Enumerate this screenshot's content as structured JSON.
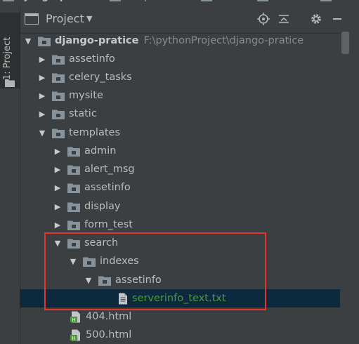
{
  "breadcrumb": [
    "django-pratice",
    "templates",
    "search",
    "indexes",
    "asse"
  ],
  "tool_window": {
    "stripe_label": "1: Project",
    "title": "Project"
  },
  "tree": {
    "root": {
      "name": "django-pratice",
      "path": "F:\\pythonProject\\django-pratice"
    },
    "items": [
      {
        "name": "assetinfo",
        "kind": "folder"
      },
      {
        "name": "celery_tasks",
        "kind": "folder"
      },
      {
        "name": "mysite",
        "kind": "folder"
      },
      {
        "name": "static",
        "kind": "folder"
      },
      {
        "name": "templates",
        "kind": "folder"
      },
      {
        "name": "admin",
        "kind": "folder"
      },
      {
        "name": "alert_msg",
        "kind": "folder"
      },
      {
        "name": "assetinfo",
        "kind": "folder"
      },
      {
        "name": "display",
        "kind": "folder"
      },
      {
        "name": "form_test",
        "kind": "folder"
      },
      {
        "name": "search",
        "kind": "folder"
      },
      {
        "name": "indexes",
        "kind": "folder"
      },
      {
        "name": "assetinfo",
        "kind": "folder"
      },
      {
        "name": "serverinfo_text.txt",
        "kind": "text-file"
      },
      {
        "name": "404.html",
        "kind": "html-file"
      },
      {
        "name": "500.html",
        "kind": "html-file"
      }
    ]
  },
  "colors": {
    "background": "#3c3f41",
    "selection": "#0d293e",
    "text": "#bbbbbb",
    "txt_file": "#4e9a3c",
    "annotation": "#e8322c"
  }
}
